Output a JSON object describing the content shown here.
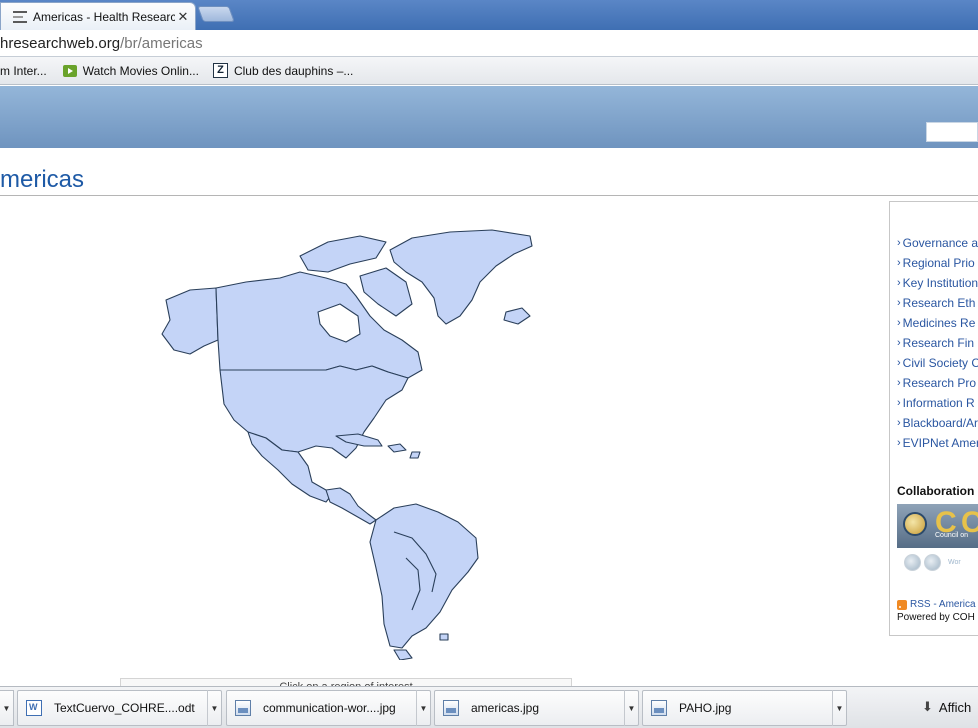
{
  "browser": {
    "tab_title": "Americas - Health Researc",
    "close_glyph": "✕",
    "url_host": "hresearchweb.org",
    "url_path": "/br/americas"
  },
  "bookmarks": [
    {
      "label": "m Inter...",
      "icon": "none"
    },
    {
      "label": "Watch Movies Onlin...",
      "icon": "play-icon"
    },
    {
      "label": "Club des dauphins –...",
      "icon": "z-icon"
    }
  ],
  "page": {
    "title": "mericas"
  },
  "sidebar": {
    "links": [
      "Governance a",
      "Regional Prio",
      "Key Institution",
      "Research Eth",
      "Medicines Re",
      "Research Fin",
      "Civil Society C",
      "Research Pro",
      "Information R",
      "Blackboard/Ar",
      "EVIPNet Amer"
    ],
    "arrow": "›",
    "collaboration_title": "Collaboration",
    "logo_big": "C C",
    "logo_small": "Council on",
    "logo_faint": "Wor",
    "rss_text": "RSS - America",
    "powered_text": "Powered by COH"
  },
  "map": {
    "caption": "Click on a region of interest"
  },
  "downloads": {
    "items": [
      {
        "label": "TextCuervo_COHRE....odt",
        "icon": "word-icon"
      },
      {
        "label": "communication-wor....jpg",
        "icon": "image-icon"
      },
      {
        "label": "americas.jpg",
        "icon": "image-icon"
      },
      {
        "label": "PAHO.jpg",
        "icon": "image-icon"
      }
    ],
    "show_all": "Affich",
    "arrow_glyph": "▼"
  },
  "colors": {
    "link_blue": "#2a56a1",
    "title_blue": "#1e5aa6",
    "map_fill": "#c4d4f7",
    "map_stroke": "#2a3f5a",
    "header_top": "#94b6d9",
    "header_bottom": "#6f94bf"
  }
}
